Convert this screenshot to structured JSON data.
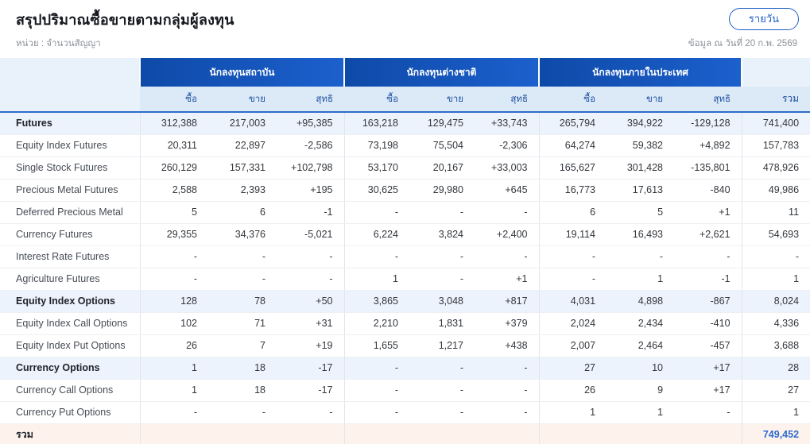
{
  "page": {
    "title": "สรุปปริมาณซื้อขายตามกลุ่มผู้ลงทุน",
    "unit_label": "หน่วย : จำนวนสัญญา",
    "as_of": "ข้อมูล ณ วันที่ 20 ก.พ. 2569",
    "period_button_label": "รายวัน"
  },
  "table": {
    "groups": [
      {
        "label": "นักลงทุนสถาบัน"
      },
      {
        "label": "นักลงทุนต่างชาติ"
      },
      {
        "label": "นักลงทุนภายในประเทศ"
      }
    ],
    "sub_headers": [
      "ซื้อ",
      "ขาย",
      "สุทธิ"
    ],
    "total_header": "รวม",
    "rows": [
      {
        "label": "Futures",
        "section": true,
        "values": [
          "312,388",
          "217,003",
          "+95,385",
          "163,218",
          "129,475",
          "+33,743",
          "265,794",
          "394,922",
          "-129,128",
          "741,400"
        ]
      },
      {
        "label": "Equity Index Futures",
        "section": false,
        "values": [
          "20,311",
          "22,897",
          "-2,586",
          "73,198",
          "75,504",
          "-2,306",
          "64,274",
          "59,382",
          "+4,892",
          "157,783"
        ]
      },
      {
        "label": "Single Stock Futures",
        "section": false,
        "values": [
          "260,129",
          "157,331",
          "+102,798",
          "53,170",
          "20,167",
          "+33,003",
          "165,627",
          "301,428",
          "-135,801",
          "478,926"
        ]
      },
      {
        "label": "Precious Metal Futures",
        "section": false,
        "values": [
          "2,588",
          "2,393",
          "+195",
          "30,625",
          "29,980",
          "+645",
          "16,773",
          "17,613",
          "-840",
          "49,986"
        ]
      },
      {
        "label": "Deferred Precious Metal",
        "section": false,
        "values": [
          "5",
          "6",
          "-1",
          "-",
          "-",
          "-",
          "6",
          "5",
          "+1",
          "11"
        ]
      },
      {
        "label": "Currency Futures",
        "section": false,
        "values": [
          "29,355",
          "34,376",
          "-5,021",
          "6,224",
          "3,824",
          "+2,400",
          "19,114",
          "16,493",
          "+2,621",
          "54,693"
        ]
      },
      {
        "label": "Interest Rate Futures",
        "section": false,
        "values": [
          "-",
          "-",
          "-",
          "-",
          "-",
          "-",
          "-",
          "-",
          "-",
          "-"
        ]
      },
      {
        "label": "Agriculture Futures",
        "section": false,
        "values": [
          "-",
          "-",
          "-",
          "1",
          "-",
          "+1",
          "-",
          "1",
          "-1",
          "1"
        ]
      },
      {
        "label": "Equity Index Options",
        "section": true,
        "values": [
          "128",
          "78",
          "+50",
          "3,865",
          "3,048",
          "+817",
          "4,031",
          "4,898",
          "-867",
          "8,024"
        ]
      },
      {
        "label": "Equity Index Call Options",
        "section": false,
        "values": [
          "102",
          "71",
          "+31",
          "2,210",
          "1,831",
          "+379",
          "2,024",
          "2,434",
          "-410",
          "4,336"
        ]
      },
      {
        "label": "Equity Index Put Options",
        "section": false,
        "values": [
          "26",
          "7",
          "+19",
          "1,655",
          "1,217",
          "+438",
          "2,007",
          "2,464",
          "-457",
          "3,688"
        ]
      },
      {
        "label": "Currency Options",
        "section": true,
        "values": [
          "1",
          "18",
          "-17",
          "-",
          "-",
          "-",
          "27",
          "10",
          "+17",
          "28"
        ]
      },
      {
        "label": "Currency Call Options",
        "section": false,
        "values": [
          "1",
          "18",
          "-17",
          "-",
          "-",
          "-",
          "26",
          "9",
          "+17",
          "27"
        ]
      },
      {
        "label": "Currency Put Options",
        "section": false,
        "values": [
          "-",
          "-",
          "-",
          "-",
          "-",
          "-",
          "1",
          "1",
          "-",
          "1"
        ]
      }
    ],
    "footer": {
      "label": "รวม",
      "values": [
        "",
        "",
        "",
        "",
        "",
        "",
        "",
        "",
        ""
      ],
      "total": "749,452"
    }
  },
  "colors": {
    "accent_blue": "#2260c4",
    "header_gradient_start": "#0e4aa8",
    "header_gradient_end": "#1c60cd",
    "subheader_bg": "#dce9f7",
    "subheader_text": "#1c4f9f",
    "positive_green": "#1fa36c",
    "negative_red": "#e25f6b",
    "section_row_bg": "#edf3fc",
    "footer_bg": "#fdf3ec",
    "total_value_blue": "#2f6bce",
    "dash_gray": "#9aa0a6"
  }
}
